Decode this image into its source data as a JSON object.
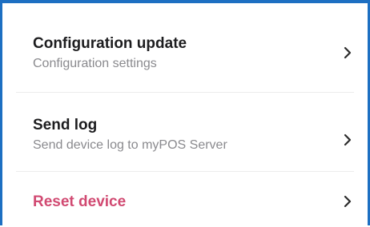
{
  "settings": {
    "items": [
      {
        "title": "Configuration update",
        "subtitle": "Configuration settings"
      },
      {
        "title": "Send log",
        "subtitle": "Send device log to myPOS Server"
      },
      {
        "title": "Reset device",
        "subtitle": ""
      }
    ],
    "chevron_icon": "chevron-right-icon",
    "accent_color": "#1d6fc2",
    "danger_color": "#d14a72"
  }
}
